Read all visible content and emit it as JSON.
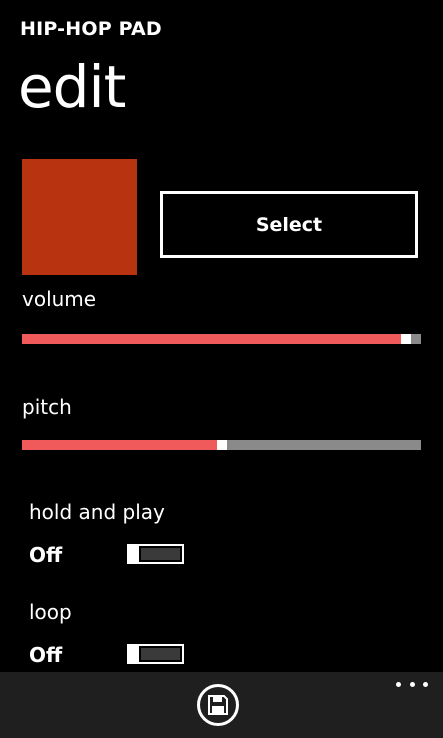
{
  "header": {
    "app_title": "HIP-HOP PAD",
    "page_title": "edit"
  },
  "pad": {
    "color": "#b8330f",
    "select_label": "Select"
  },
  "volume": {
    "label": "volume",
    "value": 0.975,
    "fill_color": "#f05a5a",
    "track_color": "#8a8a8a"
  },
  "pitch": {
    "label": "pitch",
    "value": 0.5,
    "fill_color": "#f05a5a",
    "track_color": "#8a8a8a"
  },
  "hold_and_play": {
    "label": "hold and play",
    "state": "Off",
    "on": false
  },
  "loop": {
    "label": "loop",
    "state": "Off",
    "on": false
  },
  "app_bar": {
    "save_icon": "save-icon",
    "more_icon": "more-icon",
    "background": "#1f1f1f"
  }
}
